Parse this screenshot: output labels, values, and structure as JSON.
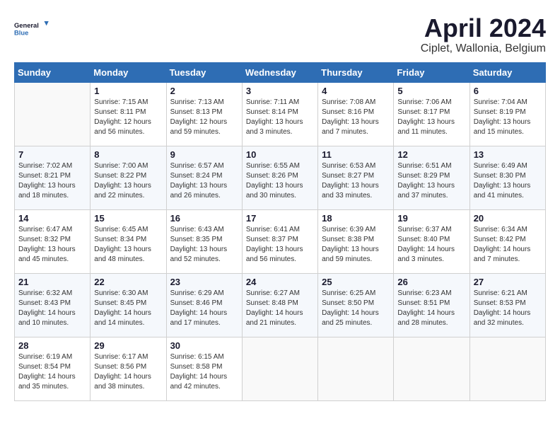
{
  "header": {
    "logo_line1": "General",
    "logo_line2": "Blue",
    "month_title": "April 2024",
    "location": "Ciplet, Wallonia, Belgium"
  },
  "weekdays": [
    "Sunday",
    "Monday",
    "Tuesday",
    "Wednesday",
    "Thursday",
    "Friday",
    "Saturday"
  ],
  "weeks": [
    [
      {
        "day": "",
        "sunrise": "",
        "sunset": "",
        "daylight": ""
      },
      {
        "day": "1",
        "sunrise": "Sunrise: 7:15 AM",
        "sunset": "Sunset: 8:11 PM",
        "daylight": "Daylight: 12 hours and 56 minutes."
      },
      {
        "day": "2",
        "sunrise": "Sunrise: 7:13 AM",
        "sunset": "Sunset: 8:13 PM",
        "daylight": "Daylight: 12 hours and 59 minutes."
      },
      {
        "day": "3",
        "sunrise": "Sunrise: 7:11 AM",
        "sunset": "Sunset: 8:14 PM",
        "daylight": "Daylight: 13 hours and 3 minutes."
      },
      {
        "day": "4",
        "sunrise": "Sunrise: 7:08 AM",
        "sunset": "Sunset: 8:16 PM",
        "daylight": "Daylight: 13 hours and 7 minutes."
      },
      {
        "day": "5",
        "sunrise": "Sunrise: 7:06 AM",
        "sunset": "Sunset: 8:17 PM",
        "daylight": "Daylight: 13 hours and 11 minutes."
      },
      {
        "day": "6",
        "sunrise": "Sunrise: 7:04 AM",
        "sunset": "Sunset: 8:19 PM",
        "daylight": "Daylight: 13 hours and 15 minutes."
      }
    ],
    [
      {
        "day": "7",
        "sunrise": "Sunrise: 7:02 AM",
        "sunset": "Sunset: 8:21 PM",
        "daylight": "Daylight: 13 hours and 18 minutes."
      },
      {
        "day": "8",
        "sunrise": "Sunrise: 7:00 AM",
        "sunset": "Sunset: 8:22 PM",
        "daylight": "Daylight: 13 hours and 22 minutes."
      },
      {
        "day": "9",
        "sunrise": "Sunrise: 6:57 AM",
        "sunset": "Sunset: 8:24 PM",
        "daylight": "Daylight: 13 hours and 26 minutes."
      },
      {
        "day": "10",
        "sunrise": "Sunrise: 6:55 AM",
        "sunset": "Sunset: 8:26 PM",
        "daylight": "Daylight: 13 hours and 30 minutes."
      },
      {
        "day": "11",
        "sunrise": "Sunrise: 6:53 AM",
        "sunset": "Sunset: 8:27 PM",
        "daylight": "Daylight: 13 hours and 33 minutes."
      },
      {
        "day": "12",
        "sunrise": "Sunrise: 6:51 AM",
        "sunset": "Sunset: 8:29 PM",
        "daylight": "Daylight: 13 hours and 37 minutes."
      },
      {
        "day": "13",
        "sunrise": "Sunrise: 6:49 AM",
        "sunset": "Sunset: 8:30 PM",
        "daylight": "Daylight: 13 hours and 41 minutes."
      }
    ],
    [
      {
        "day": "14",
        "sunrise": "Sunrise: 6:47 AM",
        "sunset": "Sunset: 8:32 PM",
        "daylight": "Daylight: 13 hours and 45 minutes."
      },
      {
        "day": "15",
        "sunrise": "Sunrise: 6:45 AM",
        "sunset": "Sunset: 8:34 PM",
        "daylight": "Daylight: 13 hours and 48 minutes."
      },
      {
        "day": "16",
        "sunrise": "Sunrise: 6:43 AM",
        "sunset": "Sunset: 8:35 PM",
        "daylight": "Daylight: 13 hours and 52 minutes."
      },
      {
        "day": "17",
        "sunrise": "Sunrise: 6:41 AM",
        "sunset": "Sunset: 8:37 PM",
        "daylight": "Daylight: 13 hours and 56 minutes."
      },
      {
        "day": "18",
        "sunrise": "Sunrise: 6:39 AM",
        "sunset": "Sunset: 8:38 PM",
        "daylight": "Daylight: 13 hours and 59 minutes."
      },
      {
        "day": "19",
        "sunrise": "Sunrise: 6:37 AM",
        "sunset": "Sunset: 8:40 PM",
        "daylight": "Daylight: 14 hours and 3 minutes."
      },
      {
        "day": "20",
        "sunrise": "Sunrise: 6:34 AM",
        "sunset": "Sunset: 8:42 PM",
        "daylight": "Daylight: 14 hours and 7 minutes."
      }
    ],
    [
      {
        "day": "21",
        "sunrise": "Sunrise: 6:32 AM",
        "sunset": "Sunset: 8:43 PM",
        "daylight": "Daylight: 14 hours and 10 minutes."
      },
      {
        "day": "22",
        "sunrise": "Sunrise: 6:30 AM",
        "sunset": "Sunset: 8:45 PM",
        "daylight": "Daylight: 14 hours and 14 minutes."
      },
      {
        "day": "23",
        "sunrise": "Sunrise: 6:29 AM",
        "sunset": "Sunset: 8:46 PM",
        "daylight": "Daylight: 14 hours and 17 minutes."
      },
      {
        "day": "24",
        "sunrise": "Sunrise: 6:27 AM",
        "sunset": "Sunset: 8:48 PM",
        "daylight": "Daylight: 14 hours and 21 minutes."
      },
      {
        "day": "25",
        "sunrise": "Sunrise: 6:25 AM",
        "sunset": "Sunset: 8:50 PM",
        "daylight": "Daylight: 14 hours and 25 minutes."
      },
      {
        "day": "26",
        "sunrise": "Sunrise: 6:23 AM",
        "sunset": "Sunset: 8:51 PM",
        "daylight": "Daylight: 14 hours and 28 minutes."
      },
      {
        "day": "27",
        "sunrise": "Sunrise: 6:21 AM",
        "sunset": "Sunset: 8:53 PM",
        "daylight": "Daylight: 14 hours and 32 minutes."
      }
    ],
    [
      {
        "day": "28",
        "sunrise": "Sunrise: 6:19 AM",
        "sunset": "Sunset: 8:54 PM",
        "daylight": "Daylight: 14 hours and 35 minutes."
      },
      {
        "day": "29",
        "sunrise": "Sunrise: 6:17 AM",
        "sunset": "Sunset: 8:56 PM",
        "daylight": "Daylight: 14 hours and 38 minutes."
      },
      {
        "day": "30",
        "sunrise": "Sunrise: 6:15 AM",
        "sunset": "Sunset: 8:58 PM",
        "daylight": "Daylight: 14 hours and 42 minutes."
      },
      {
        "day": "",
        "sunrise": "",
        "sunset": "",
        "daylight": ""
      },
      {
        "day": "",
        "sunrise": "",
        "sunset": "",
        "daylight": ""
      },
      {
        "day": "",
        "sunrise": "",
        "sunset": "",
        "daylight": ""
      },
      {
        "day": "",
        "sunrise": "",
        "sunset": "",
        "daylight": ""
      }
    ]
  ]
}
